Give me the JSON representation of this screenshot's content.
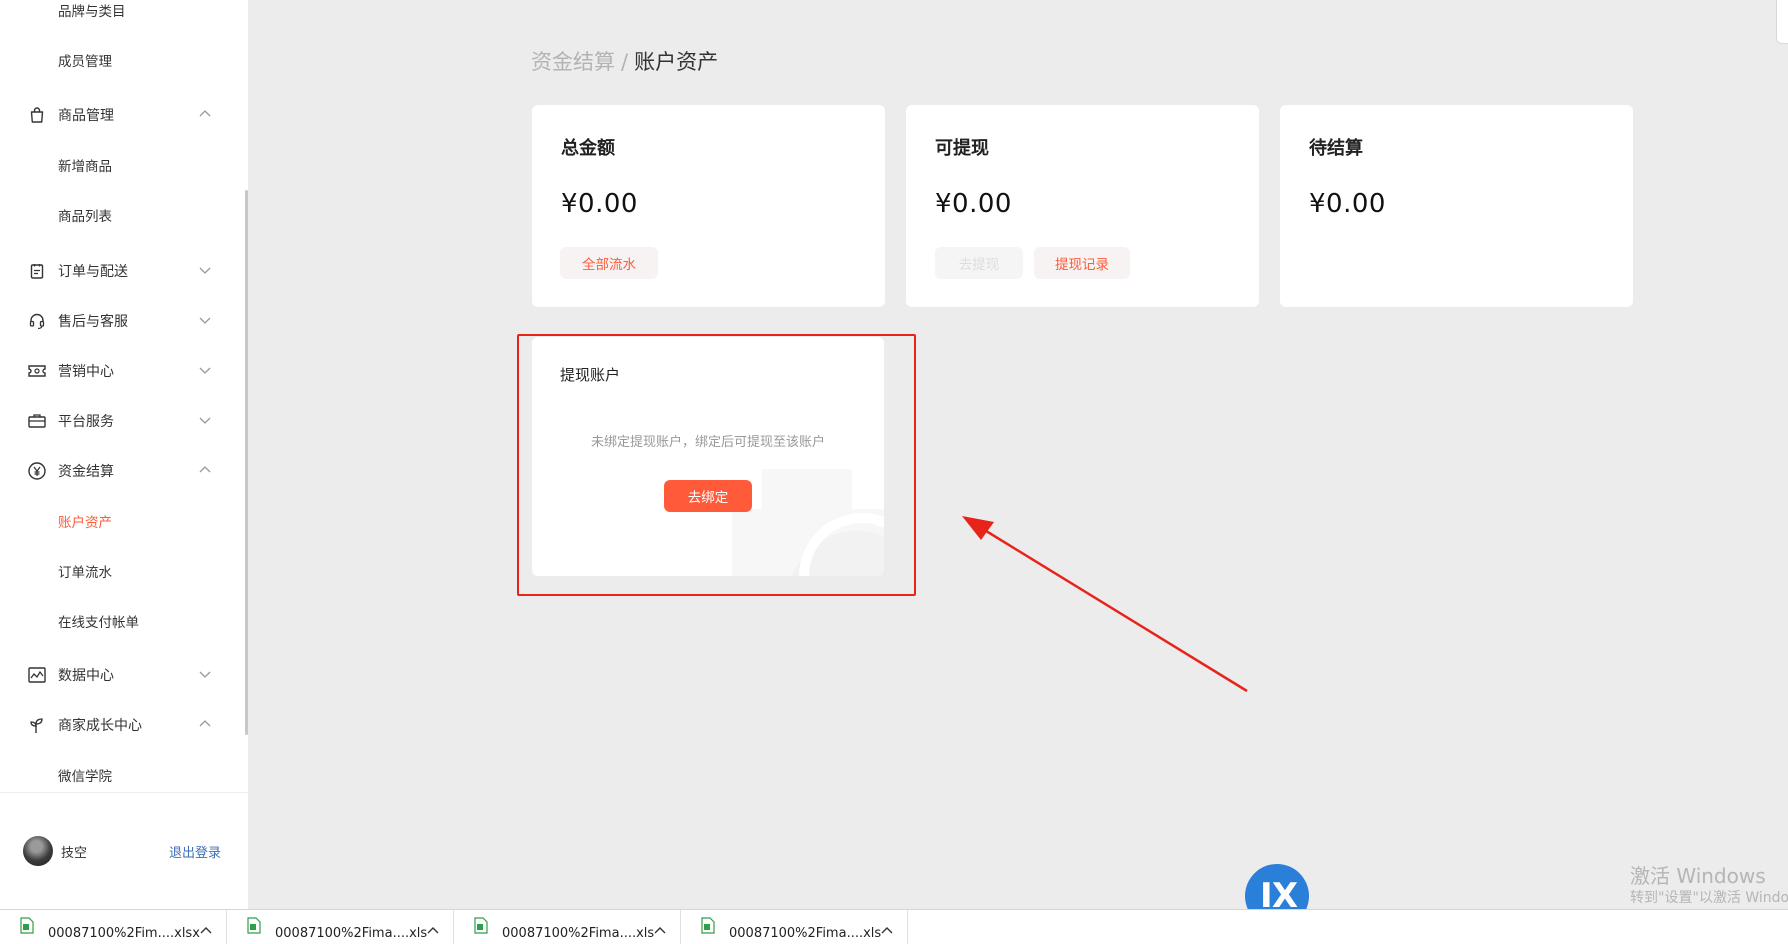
{
  "sidebar": {
    "items": [
      {
        "label": "品牌与类目",
        "icon": "",
        "chevron": "",
        "level": "sub"
      },
      {
        "label": "成员管理",
        "icon": "",
        "chevron": "",
        "level": "sub"
      },
      {
        "label": "商品管理",
        "icon": "shopping-bag-icon",
        "chevron": "up",
        "level": "top"
      },
      {
        "label": "新增商品",
        "icon": "",
        "chevron": "",
        "level": "sub"
      },
      {
        "label": "商品列表",
        "icon": "",
        "chevron": "",
        "level": "sub"
      },
      {
        "label": "订单与配送",
        "icon": "clipboard-icon",
        "chevron": "down",
        "level": "top"
      },
      {
        "label": "售后与客服",
        "icon": "headset-icon",
        "chevron": "down",
        "level": "top"
      },
      {
        "label": "营销中心",
        "icon": "ticket-icon",
        "chevron": "down",
        "level": "top"
      },
      {
        "label": "平台服务",
        "icon": "briefcase-icon",
        "chevron": "down",
        "level": "top"
      },
      {
        "label": "资金结算",
        "icon": "yen-circle-icon",
        "chevron": "up",
        "level": "top"
      },
      {
        "label": "账户资产",
        "icon": "",
        "chevron": "",
        "level": "sub",
        "active": true
      },
      {
        "label": "订单流水",
        "icon": "",
        "chevron": "",
        "level": "sub"
      },
      {
        "label": "在线支付帐单",
        "icon": "",
        "chevron": "",
        "level": "sub"
      },
      {
        "label": "数据中心",
        "icon": "chart-icon",
        "chevron": "down",
        "level": "top"
      },
      {
        "label": "商家成长中心",
        "icon": "sprout-icon",
        "chevron": "up",
        "level": "top"
      },
      {
        "label": "微信学院",
        "icon": "",
        "chevron": "",
        "level": "sub"
      }
    ],
    "user": {
      "name": "技空",
      "logout_label": "退出登录"
    }
  },
  "breadcrumb": {
    "parent": "资金结算",
    "separator": "/",
    "current": "账户资产"
  },
  "cards": [
    {
      "title": "总金额",
      "amount": "¥0.00",
      "buttons": [
        {
          "label": "全部流水",
          "disabled": false
        }
      ]
    },
    {
      "title": "可提现",
      "amount": "¥0.00",
      "buttons": [
        {
          "label": "去提现",
          "disabled": true
        },
        {
          "label": "提现记录",
          "disabled": false
        }
      ]
    },
    {
      "title": "待结算",
      "amount": "¥0.00",
      "buttons": []
    }
  ],
  "withdraw_account": {
    "title": "提现账户",
    "description": "未绑定提现账户，绑定后可提现至该账户",
    "bind_label": "去绑定"
  },
  "annotation": {
    "highlight_color": "#e8231a"
  },
  "floating_badge": {
    "text": "Ⅸ",
    "color": "#2a7fd8"
  },
  "watermark": {
    "title": "激活 Windows",
    "subtitle": "转到\"设置\"以激活 Windows。"
  },
  "downloads": [
    {
      "name": "00087100%2Fim....xlsx"
    },
    {
      "name": "00087100%2Fima....xls"
    },
    {
      "name": "00087100%2Fima....xls"
    },
    {
      "name": "00087100%2Fima....xls"
    }
  ],
  "colors": {
    "accent": "#ff5b3a",
    "link": "#3e6eb5",
    "background": "#ececec"
  }
}
